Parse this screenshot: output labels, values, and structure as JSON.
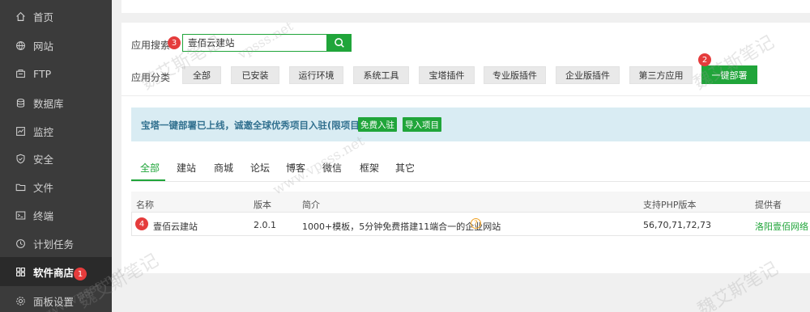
{
  "sidebar": {
    "items": [
      {
        "label": "首页",
        "icon": "home-icon"
      },
      {
        "label": "网站",
        "icon": "globe-icon"
      },
      {
        "label": "FTP",
        "icon": "ftp-icon"
      },
      {
        "label": "数据库",
        "icon": "database-icon"
      },
      {
        "label": "监控",
        "icon": "monitor-icon"
      },
      {
        "label": "安全",
        "icon": "shield-icon"
      },
      {
        "label": "文件",
        "icon": "folder-icon"
      },
      {
        "label": "终端",
        "icon": "terminal-icon"
      },
      {
        "label": "计划任务",
        "icon": "clock-icon"
      },
      {
        "label": "软件商店",
        "icon": "apps-icon",
        "active": true
      },
      {
        "label": "面板设置",
        "icon": "gear-icon"
      }
    ],
    "badge": "1"
  },
  "search": {
    "label": "应用搜索",
    "value": "壹佰云建站",
    "badge": "3"
  },
  "categories": {
    "label": "应用分类",
    "items": [
      "全部",
      "已安装",
      "运行环境",
      "系统工具",
      "宝塔插件",
      "专业版插件",
      "企业版插件",
      "第三方应用",
      "一键部署"
    ],
    "badge": "2"
  },
  "notice": {
    "text": "宝塔一键部署已上线，诚邀全球优秀项目入驻(限项目官方)",
    "btn_join": "免费入驻",
    "btn_import": "导入项目"
  },
  "tabs": [
    "全部",
    "建站",
    "商城",
    "论坛",
    "博客",
    "微信",
    "框架",
    "其它"
  ],
  "table": {
    "headers": [
      "名称",
      "版本",
      "简介",
      "支持PHP版本",
      "提供者"
    ],
    "rows": [
      {
        "name": "壹佰云建站",
        "version": "2.0.1",
        "desc": "1000+模板，5分钟免费搭建11端合一的企业网站",
        "php": "56,70,71,72,73",
        "provider": "洛阳壹佰网络",
        "badge": "4"
      }
    ]
  },
  "watermarks": [
    "魏艾斯笔记",
    "vpsss.net",
    "魏艾斯笔记",
    "www.vpsss.net",
    "魏艾斯笔记",
    "www.vpsss.net",
    "魏艾斯笔记"
  ],
  "colors": {
    "accent": "#20a53a",
    "sidebar": "#3b3b3b",
    "badge": "#e53c3c",
    "notice": "#d9ecf3"
  }
}
